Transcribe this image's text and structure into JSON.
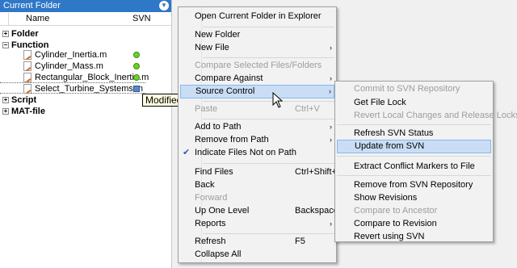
{
  "panel": {
    "title": "Current Folder",
    "columns": {
      "name": "Name",
      "svn": "SVN"
    }
  },
  "tree": {
    "folder": "Folder",
    "function": "Function",
    "files": [
      {
        "name": "Cylinder_Inertia.m",
        "status": "up-to-date"
      },
      {
        "name": "Cylinder_Mass.m",
        "status": "up-to-date"
      },
      {
        "name": "Rectangular_Block_Inertia.m",
        "status": "up-to-date"
      },
      {
        "name": "Select_Turbine_Systems.m",
        "status": "modified"
      }
    ],
    "script": "Script",
    "matfile": "MAT-file"
  },
  "tooltip": "Modified",
  "context_menu": {
    "open_folder": "Open Current Folder in Explorer",
    "new_folder": "New Folder",
    "new_file": "New File",
    "compare_selected": "Compare Selected Files/Folders",
    "compare_against": "Compare Against",
    "source_control": "Source Control",
    "paste": "Paste",
    "paste_shortcut": "Ctrl+V",
    "add_to_path": "Add to Path",
    "remove_from_path": "Remove from Path",
    "indicate_files": "Indicate Files Not on Path",
    "find_files": "Find Files",
    "find_files_shortcut": "Ctrl+Shift+F",
    "back": "Back",
    "forward": "Forward",
    "up_one_level": "Up One Level",
    "up_one_level_shortcut": "Backspace",
    "reports": "Reports",
    "refresh": "Refresh",
    "refresh_shortcut": "F5",
    "collapse_all": "Collapse All"
  },
  "submenu": {
    "commit": "Commit to SVN Repository",
    "get_lock": "Get File Lock",
    "revert_local": "Revert Local Changes and Release Locks",
    "refresh_status": "Refresh SVN Status",
    "update": "Update from SVN",
    "extract_conflict": "Extract Conflict Markers to File",
    "remove_repo": "Remove from SVN Repository",
    "show_revisions": "Show Revisions",
    "compare_ancestor": "Compare to Ancestor",
    "compare_revision": "Compare to Revision",
    "revert_svn": "Revert using SVN"
  },
  "colors": {
    "title_bar": "#2f77c7",
    "highlight": "#c9def5",
    "status_ok": "#6ccf2e",
    "status_modified": "#5b86c8"
  }
}
